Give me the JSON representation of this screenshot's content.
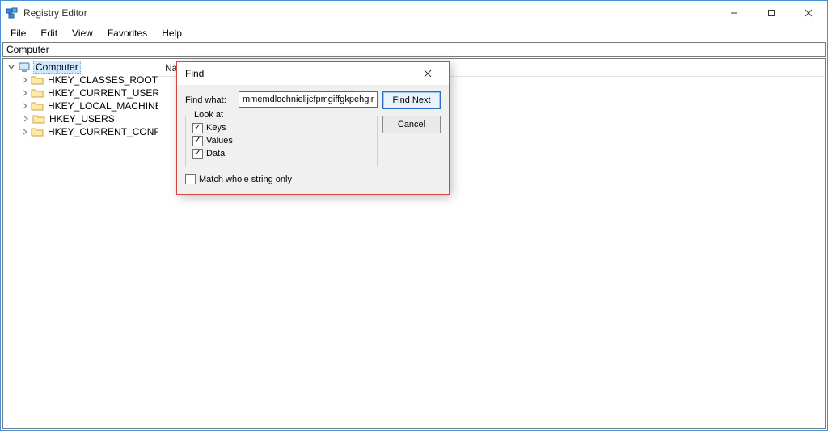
{
  "window": {
    "title": "Registry Editor",
    "controls": {
      "minimize": "min",
      "maximize": "max",
      "close": "close"
    }
  },
  "menu": {
    "file": "File",
    "edit": "Edit",
    "view": "View",
    "favorites": "Favorites",
    "help": "Help"
  },
  "address": "Computer",
  "tree": {
    "root": "Computer",
    "items": [
      "HKEY_CLASSES_ROOT",
      "HKEY_CURRENT_USER",
      "HKEY_LOCAL_MACHINE",
      "HKEY_USERS",
      "HKEY_CURRENT_CONFIG"
    ]
  },
  "list": {
    "col_name": "Name"
  },
  "dialog": {
    "title": "Find",
    "find_what_label": "Find what:",
    "find_what_value": "mmemdlochnielijcfpmgiffgkpehginj",
    "look_at_label": "Look at",
    "keys_label": "Keys",
    "values_label": "Values",
    "data_label": "Data",
    "keys_checked": true,
    "values_checked": true,
    "data_checked": true,
    "match_whole_label": "Match whole string only",
    "match_whole_checked": false,
    "find_next": "Find Next",
    "cancel": "Cancel"
  }
}
